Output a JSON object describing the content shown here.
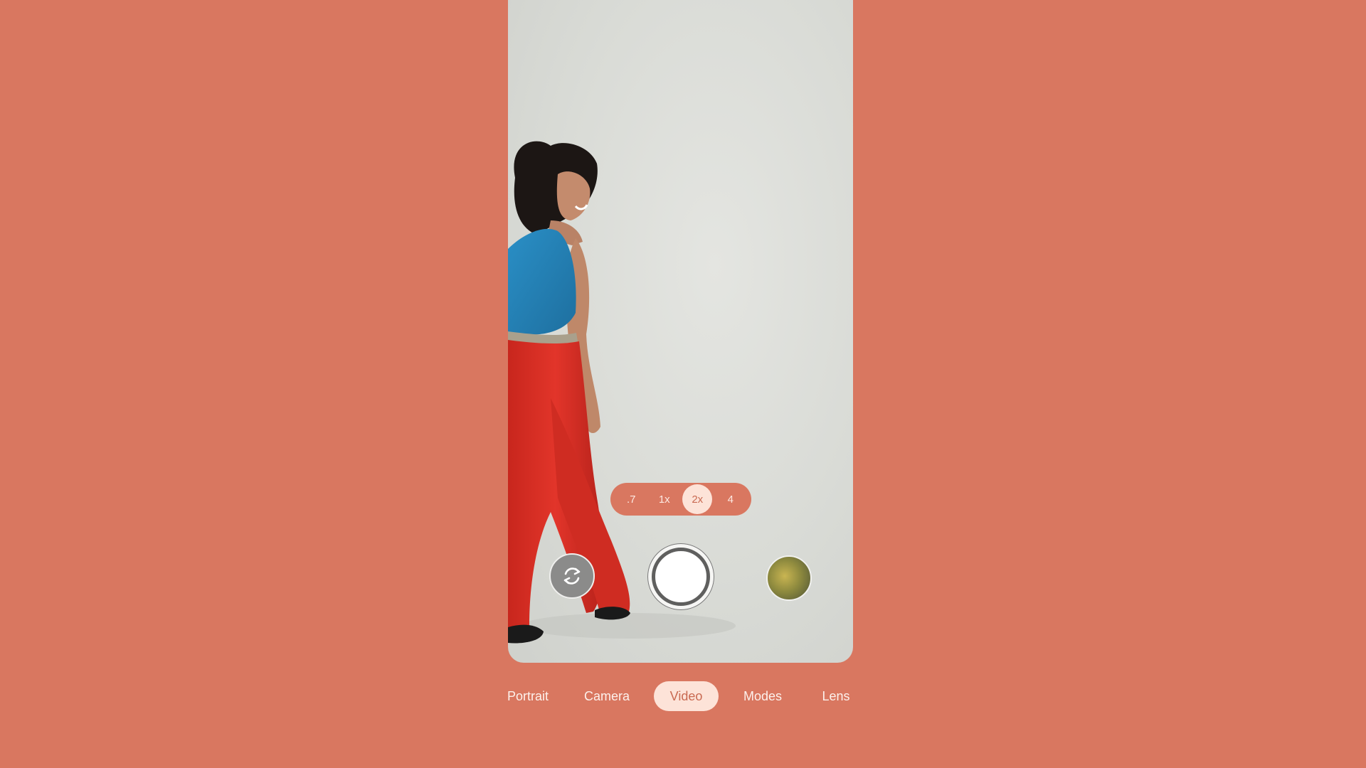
{
  "colors": {
    "background": "#d97760",
    "active_chip": "#fde3d8",
    "active_text": "#c96a52"
  },
  "zoom": {
    "options": [
      ".7",
      "1x",
      "2x",
      "4"
    ],
    "selected": "2x"
  },
  "controls": {
    "flip_icon": "camera-flip-icon",
    "shutter_icon": "shutter-icon",
    "thumbnail_icon": "gallery-thumbnail"
  },
  "modes": {
    "items": [
      "Portrait",
      "Camera",
      "Video",
      "Modes",
      "Lens"
    ],
    "selected": "Video"
  }
}
